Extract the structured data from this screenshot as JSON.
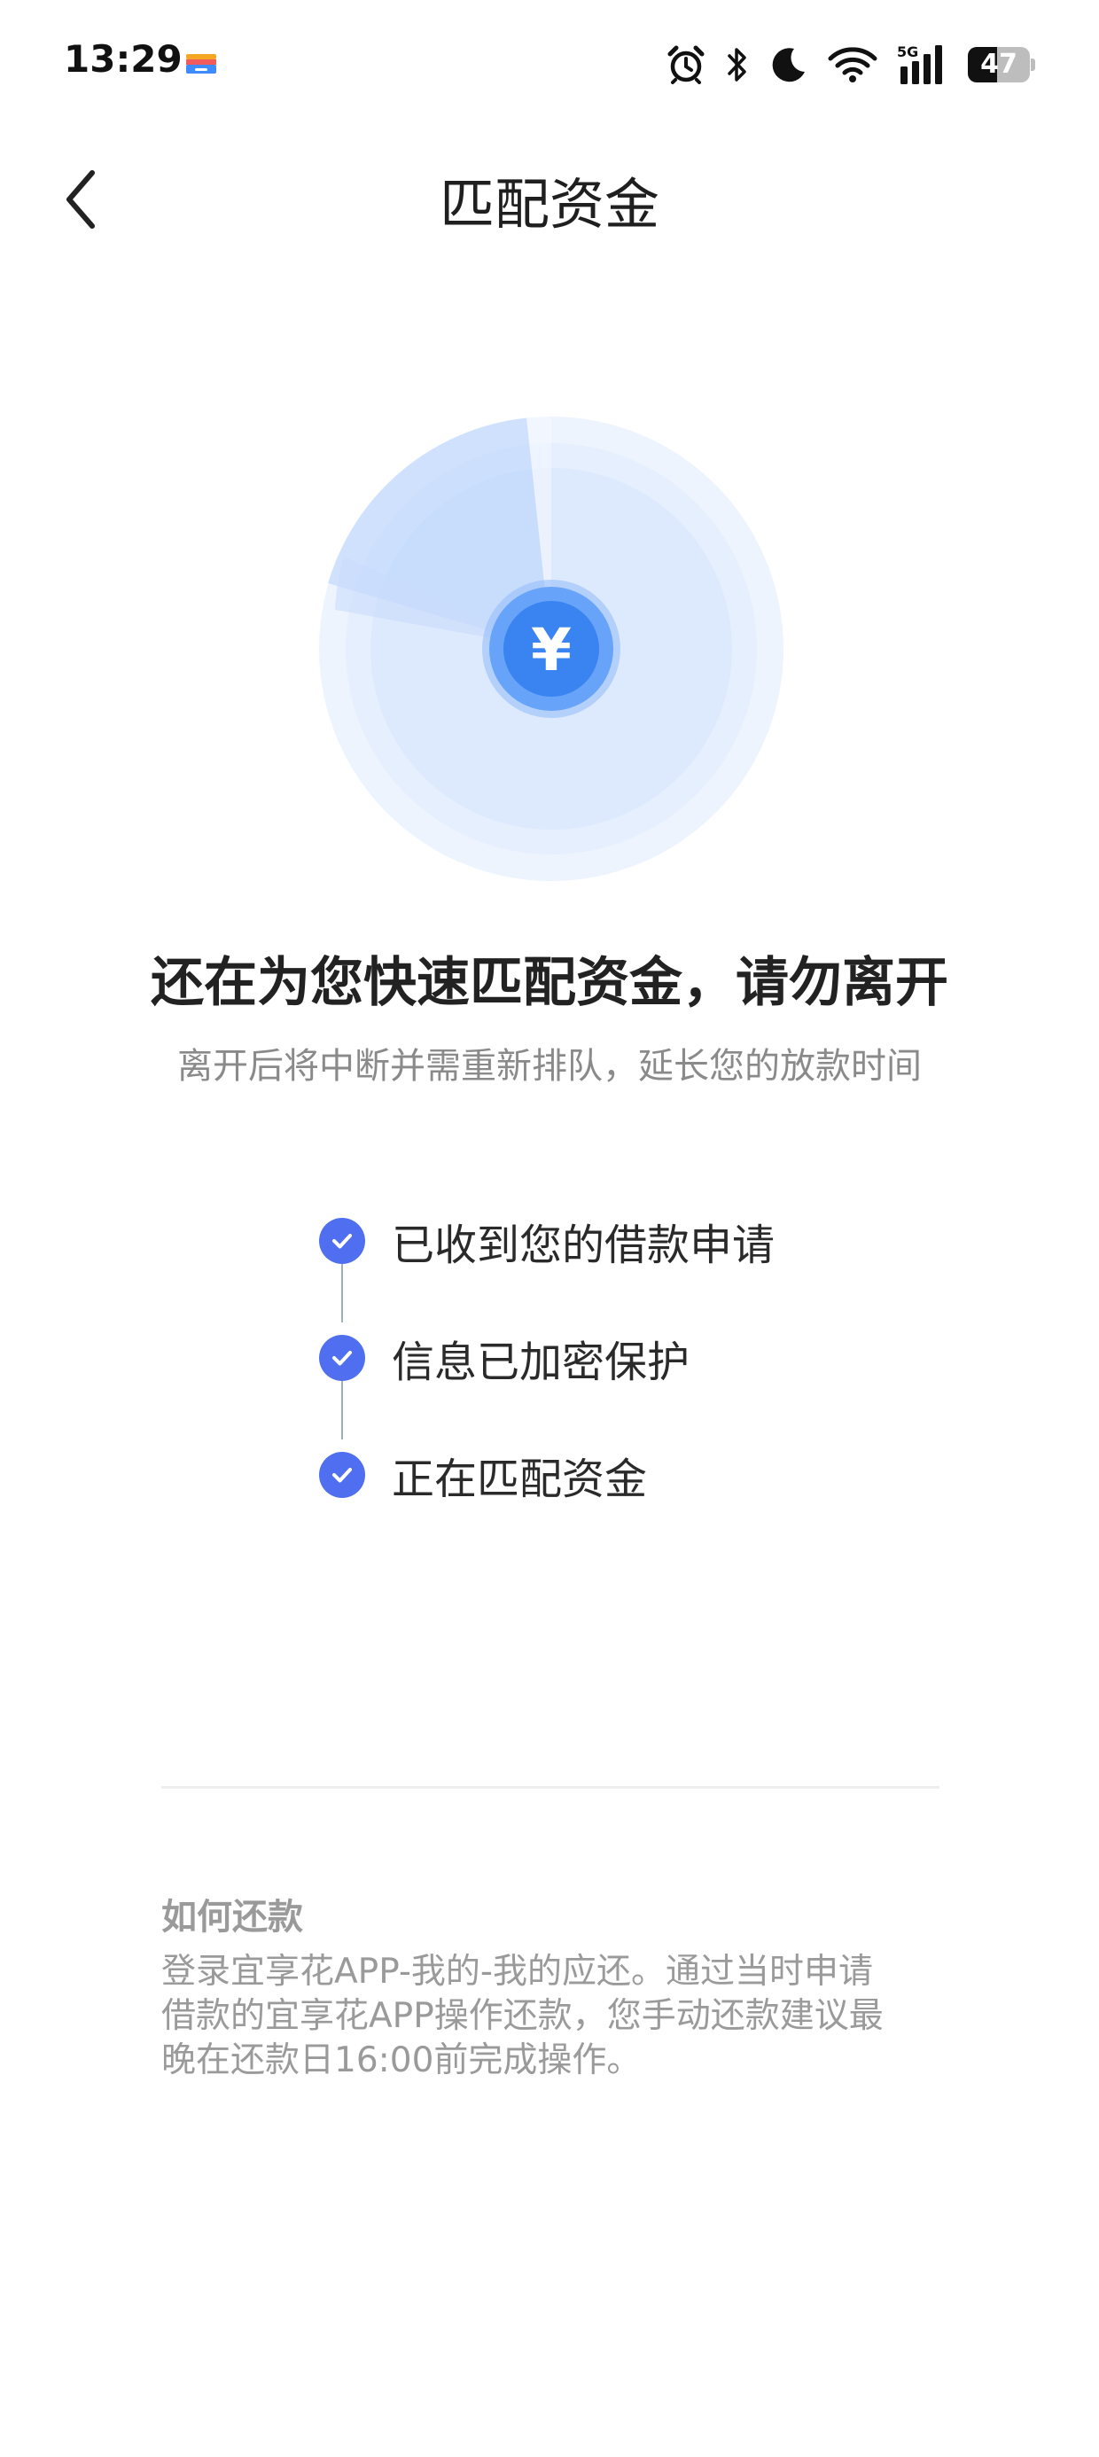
{
  "status_bar": {
    "time": "13:29",
    "battery_level": "47",
    "battery_fraction": 0.47,
    "icons": [
      "alarm-icon",
      "bluetooth-icon",
      "do-not-disturb-moon-icon",
      "wifi-icon",
      "5g-signal-icon",
      "battery-icon"
    ],
    "network_label": "5G"
  },
  "nav": {
    "title": "匹配资金",
    "back_icon": "chevron-left-icon"
  },
  "illustration": {
    "center_symbol": "¥",
    "colors": {
      "outer": "#eef4fe",
      "inner": "#dbe8fd",
      "sweep": "#b7d1fb",
      "coin_outer": "#67a3f8",
      "coin_inner": "#3a84f1"
    }
  },
  "headline": "还在为您快速匹配资金，请勿离开",
  "subline": "离开后将中断并需重新排队，延长您的放款时间",
  "steps": [
    {
      "label": "已收到您的借款申请",
      "done": true
    },
    {
      "label": "信息已加密保护",
      "done": true
    },
    {
      "label": "正在匹配资金",
      "done": true
    }
  ],
  "repayment": {
    "title": "如何还款",
    "lines": [
      "登录宜享花APP-我的-我的应还。通过当时申请",
      "借款的宜享花APP操作还款，您手动还款建议最",
      "晚在还款日16:00前完成操作。"
    ]
  },
  "colors": {
    "accent": "#4f6ff0",
    "connector": "#9fb1b5",
    "muted_text": "#9a9a9a"
  }
}
